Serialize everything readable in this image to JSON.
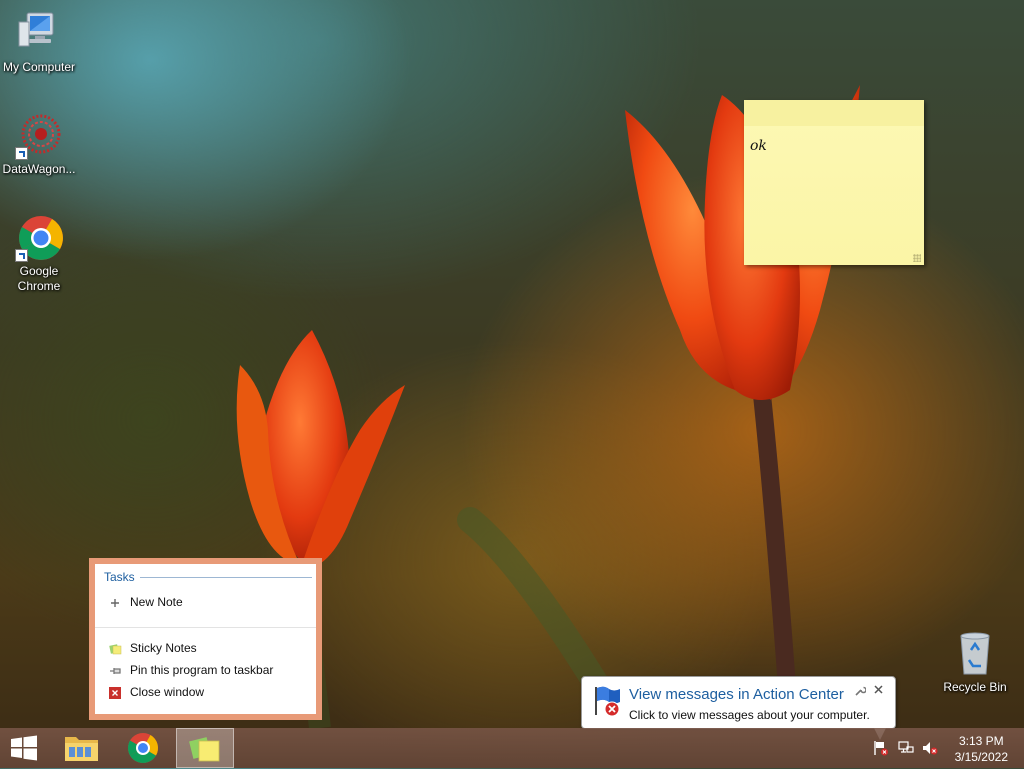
{
  "desktop": {
    "icons": [
      {
        "label": "My Computer"
      },
      {
        "label": "DataWagon..."
      },
      {
        "label": "Google Chrome"
      },
      {
        "label": "Recycle Bin"
      }
    ]
  },
  "sticky_note": {
    "text": "ok",
    "color": "#fcf8b4"
  },
  "jump_list": {
    "section_title": "Tasks",
    "items": [
      {
        "label": "New Note",
        "icon": "plus-icon"
      },
      {
        "label": "Sticky Notes",
        "icon": "sticky-notes-icon"
      },
      {
        "label": "Pin this program to taskbar",
        "icon": "pin-icon"
      },
      {
        "label": "Close window",
        "icon": "close-icon"
      }
    ],
    "accent": "#e89a77"
  },
  "notification": {
    "title": "View messages in Action Center",
    "message": "Click to view messages about your computer.",
    "icon": "action-center-flag-icon"
  },
  "taskbar": {
    "apps": [
      {
        "name": "start-button",
        "icon": "windows-logo-icon"
      },
      {
        "name": "file-explorer",
        "icon": "folder-icon"
      },
      {
        "name": "google-chrome",
        "icon": "chrome-icon"
      },
      {
        "name": "sticky-notes",
        "icon": "sticky-notes-icon",
        "active": true
      }
    ],
    "tray_icons": [
      "action-center-flag-icon",
      "network-icon",
      "volume-muted-icon"
    ],
    "clock": {
      "time": "3:13 PM",
      "date": "3/15/2022"
    }
  }
}
